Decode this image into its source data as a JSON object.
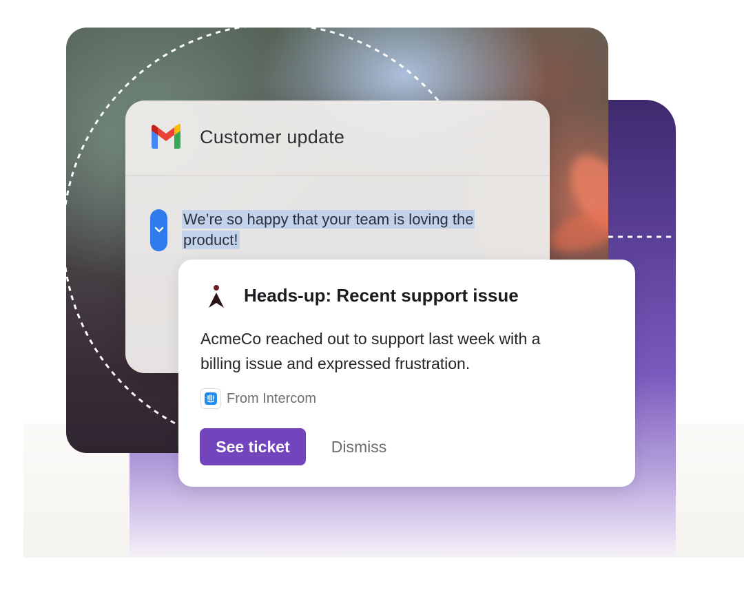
{
  "email": {
    "title": "Customer update",
    "icon": "gmail-icon",
    "body_line1": "We’re so happy that your team is loving the",
    "body_line2": "product!",
    "expand_icon": "chevron-down-icon"
  },
  "alert": {
    "icon": "presenter-icon",
    "title": "Heads-up: Recent support issue",
    "text_line1": "AcmeCo reached out to support last week with a",
    "text_line2": "billing issue and expressed frustration.",
    "source_icon": "intercom-icon",
    "source": "From Intercom",
    "primary_label": "See ticket",
    "secondary_label": "Dismiss"
  },
  "colors": {
    "accent": "#7345bd",
    "expand_pill": "#2f7bee",
    "highlight": "#c2d2ea",
    "panel_purple": "#5a3f96"
  }
}
